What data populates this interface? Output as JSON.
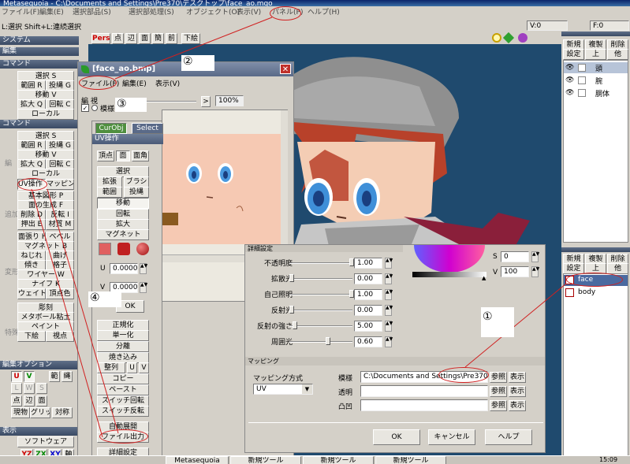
{
  "window": {
    "title": "Metasequoia - C:\\Documents and Settings\\Pre370\\デスクトップ\\face_ao.mqo"
  },
  "menubar": [
    "ファイル(F)",
    "編集(E)",
    "選択部品(S)",
    "選択部処理(S)",
    "オブジェクト(O)",
    "表示(V)",
    "パネル(P)",
    "ヘルプ(H)"
  ],
  "vcoords": [
    "V:0",
    "F:0"
  ],
  "statusbar": "L:選択  Shift+L:連続選択",
  "view_toolbar": [
    "Pers",
    "点",
    "辺",
    "面",
    "簡",
    "前",
    "下絵"
  ],
  "left_panel": {
    "system": "システム",
    "edit": "編集",
    "command_hdr": "コマンド",
    "cmd1": [
      "選択 S",
      "範囲 R",
      "投縄 G",
      "移動 V",
      "拡大 Q",
      "回転 C",
      "ローカル"
    ],
    "command2_hdr": "コマンド",
    "cmd2": [
      "選択 S",
      "範囲 R",
      "投縄 G",
      "移動 V",
      "拡大 Q",
      "回転 C",
      "ローカル",
      "UV操作 L",
      "マッピング",
      "基本図形 P",
      "面の生成 F",
      "削除 D",
      "反転 I",
      "押出 E",
      "材質 M",
      "面張り H",
      "ベベル",
      "マグネット B",
      "ねじれ",
      "曲げ",
      "傾き",
      "格子",
      "ワイヤー W",
      "ナイフ K",
      "ウェイト",
      "頂点色",
      "彫刻",
      "メタボール粘土",
      "ペイント",
      "下絵",
      "視点"
    ],
    "side_labels": [
      "編集",
      "編",
      "追加",
      "変形",
      "特殊"
    ],
    "edit_option_hdr": "編集オプション",
    "axis": [
      "U",
      "V",
      "L",
      "W",
      "S"
    ],
    "axis_labels": [
      "範",
      "縄"
    ],
    "edit_opt_btns": [
      "点",
      "辺",
      "面",
      "現物",
      "グリッド",
      "対称"
    ],
    "display_hdr": "表示",
    "display_btn": "ソフトウェア",
    "xyz": [
      "YZ",
      "ZX",
      "XY",
      "軸"
    ]
  },
  "uv_window": {
    "title": "[face_ao.bmp]",
    "menu": [
      "ファイル(F)",
      "編集(E)",
      "表示(V)"
    ],
    "tabs": [
      "編",
      "視"
    ],
    "check_label": "模様",
    "zoom": "100%",
    "curobj_tabs": [
      "CurObj",
      "Select"
    ]
  },
  "uv_panel": {
    "title": "UV操作",
    "modes": [
      "頂点",
      "面",
      "面角"
    ],
    "buttons1": [
      "選択",
      "拡張",
      "ブラシ",
      "範囲",
      "投縄",
      "移動",
      "回転",
      "拡大",
      "マグネット"
    ],
    "u_label": "U",
    "u_value": "0.0000",
    "v_label": "V",
    "v_value": "0.0000",
    "ok": "OK",
    "buttons2": [
      "正規化",
      "単一化",
      "分離",
      "焼き込み",
      "整列",
      "U",
      "V",
      "コピー",
      "ペースト",
      "スイッチ回転",
      "スイッチ反転",
      "自動展開",
      "ファイル出力",
      "詳細設定"
    ]
  },
  "material": {
    "settings_title": "詳細設定",
    "rows": [
      {
        "label": "不透明度",
        "value": "1.00",
        "level": 1.0
      },
      {
        "label": "拡散光",
        "value": "0.00",
        "level": 0.0
      },
      {
        "label": "自己照明",
        "value": "1.00",
        "level": 1.0
      },
      {
        "label": "反射光",
        "value": "0.00",
        "level": 0.0
      },
      {
        "label": "反射の強さ",
        "value": "5.00",
        "level": 0.05
      },
      {
        "label": "周囲光",
        "value": "0.60",
        "level": 0.6
      }
    ],
    "s_label": "S",
    "s_value": "0",
    "v_label": "V",
    "v_value": "100",
    "mapping_title": "マッピング",
    "mapping_method_label": "マッピング方式",
    "mapping_method": "UV",
    "tex_rows": [
      {
        "label": "模様",
        "path": "C:\\Documents and Settings\\Pre370\\デス"
      },
      {
        "label": "透明",
        "path": ""
      },
      {
        "label": "凸凹",
        "path": ""
      }
    ],
    "ref": "参照",
    "show": "表示",
    "ok": "OK",
    "cancel": "キャンセル",
    "help": "ヘルプ"
  },
  "object_panel": {
    "btns": [
      "新規",
      "複製",
      "削除",
      "設定",
      "上",
      "他"
    ],
    "items": [
      "頭",
      "腕",
      "胴体"
    ]
  },
  "material_panel": {
    "btns": [
      "新規",
      "複製",
      "削除",
      "設定",
      "上",
      "他"
    ],
    "items": [
      "face",
      "body"
    ]
  },
  "annotations": [
    "①",
    "②",
    "③",
    "④"
  ],
  "taskbar": [
    "Metasequoia",
    "新規ツール",
    "新規ツール",
    "新規ツール"
  ],
  "clock": "15:09"
}
